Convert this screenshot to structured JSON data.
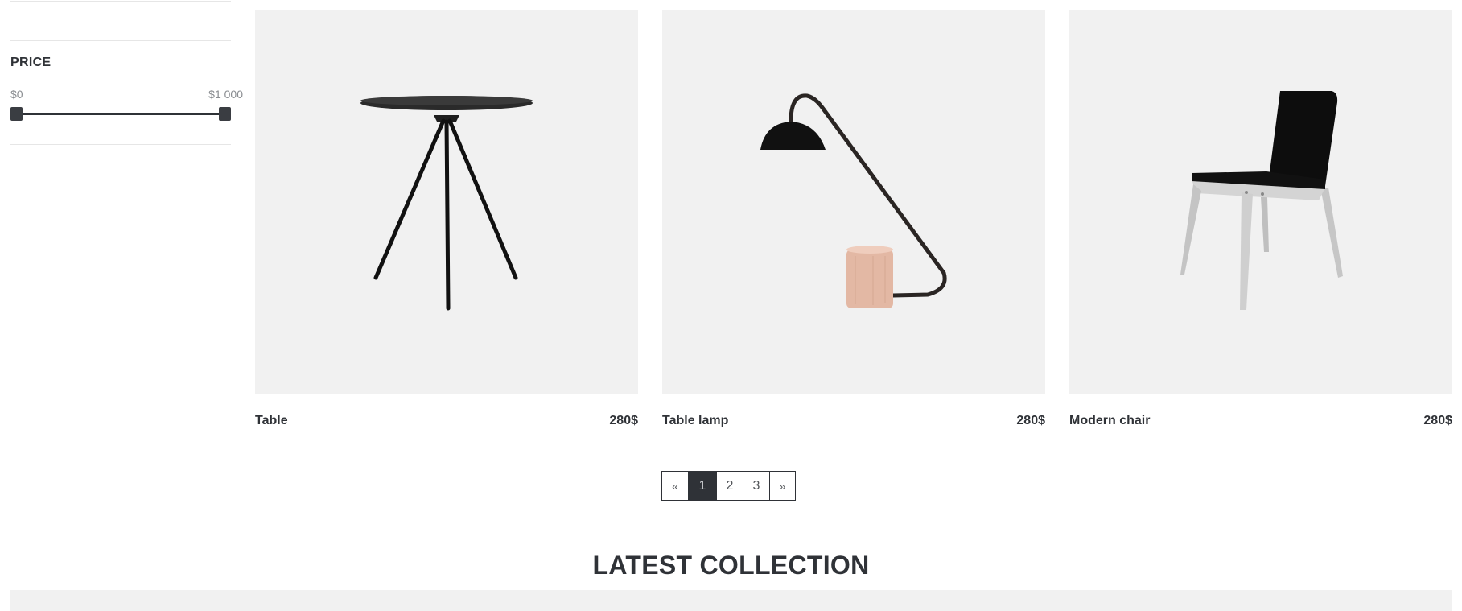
{
  "filters": {
    "price": {
      "title": "PRICE",
      "min_label": "$0",
      "max_label": "$1 000",
      "range_selected": [
        "$0",
        "$1 000"
      ]
    }
  },
  "products": [
    {
      "name": "Table",
      "price": "280$",
      "icon": "tripod-table-image"
    },
    {
      "name": "Table lamp",
      "price": "280$",
      "icon": "table-lamp-image"
    },
    {
      "name": "Modern chair",
      "price": "280$",
      "icon": "modern-chair-image"
    }
  ],
  "pagination": {
    "prev": "«",
    "pages": [
      "1",
      "2",
      "3"
    ],
    "next": "»",
    "current": "1"
  },
  "latest_collection": {
    "title": "LATEST COLLECTION"
  },
  "colors": {
    "text_dark": "#2f3237",
    "image_bg": "#f1f1f1",
    "muted": "#8a8d91",
    "divider": "#e6e6e6",
    "active_page_bg": "#2f3237"
  }
}
